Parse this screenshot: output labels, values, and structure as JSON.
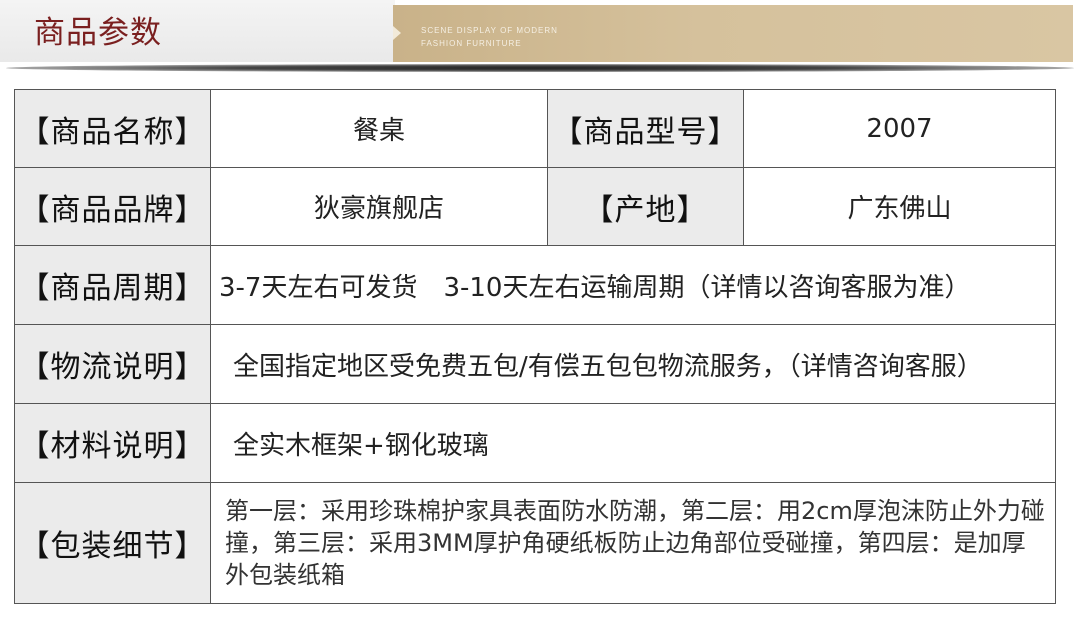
{
  "header": {
    "title": "商品参数",
    "banner_line1": "SCENE DISPLAY OF MODERN",
    "banner_line2": "FASHION FURNITURE"
  },
  "rows": [
    {
      "label": "【商品名称】",
      "value": "餐桌",
      "label2": "【商品型号】",
      "value2": "2007"
    },
    {
      "label": "【商品品牌】",
      "value": "狄豪旗舰店",
      "label2": "【产地】",
      "value2": "广东佛山"
    },
    {
      "label": "【商品周期】",
      "value": "3-7天左右可发货　3-10天左右运输周期（详情以咨询客服为准）"
    },
    {
      "label": "【物流说明】",
      "value": "全国指定地区受免费五包/有偿五包包物流服务，（详情咨询客服）"
    },
    {
      "label": "【材料说明】",
      "value": "全实木框架+钢化玻璃"
    },
    {
      "label": "【包装细节】",
      "value": "第一层：采用珍珠棉护家具表面防水防潮，第二层：用2cm厚泡沫防止外力碰撞，第三层：采用3MM厚护角硬纸板防止边角部位受碰撞，第四层：是加厚外包装纸箱"
    }
  ]
}
